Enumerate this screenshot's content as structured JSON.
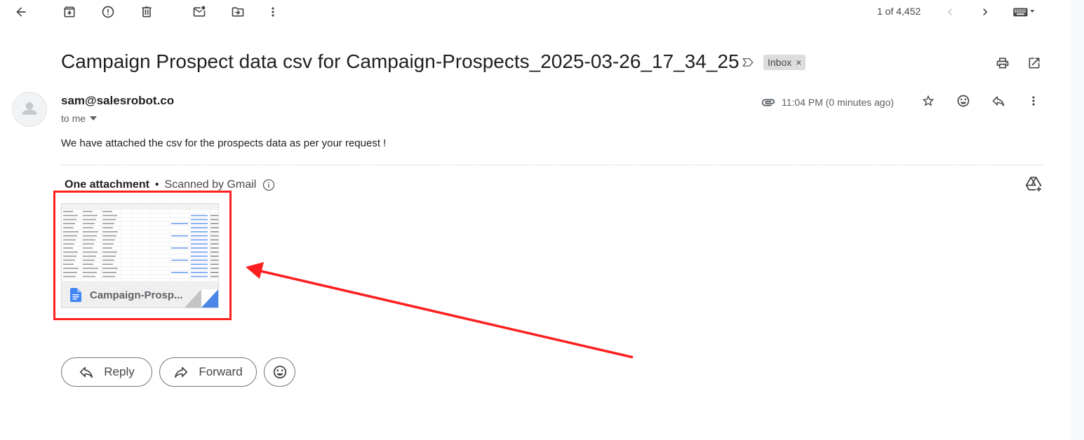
{
  "toolbar": {
    "back": "back-icon",
    "archive": "archive-icon",
    "report_spam": "spam-icon",
    "delete": "trash-icon",
    "mark_unread": "mail-icon",
    "move_to": "move-folder-icon",
    "more": "more-vert-icon",
    "pager_text": "1 of 4,452",
    "input_tools": "keyboard-icon"
  },
  "email": {
    "subject": "Campaign Prospect data csv for Campaign-Prospects_2025-03-26_17_34_25",
    "label_chip": "Inbox",
    "label_remove": "×",
    "sender": "sam@salesrobot.co",
    "recipient": "to me",
    "timestamp": "11:04 PM (0 minutes ago)",
    "body": "We have attached the csv for the prospects data as per your request !"
  },
  "attachments": {
    "count_label": "One attachment",
    "separator": "•",
    "scanned_label": "Scanned by Gmail",
    "file_name": "Campaign-Prosp..."
  },
  "actions": {
    "reply_label": "Reply",
    "forward_label": "Forward"
  },
  "colors": {
    "highlight": "#ff1f1f",
    "doc_blue": "#4285f4",
    "icon_gray": "#444746"
  }
}
